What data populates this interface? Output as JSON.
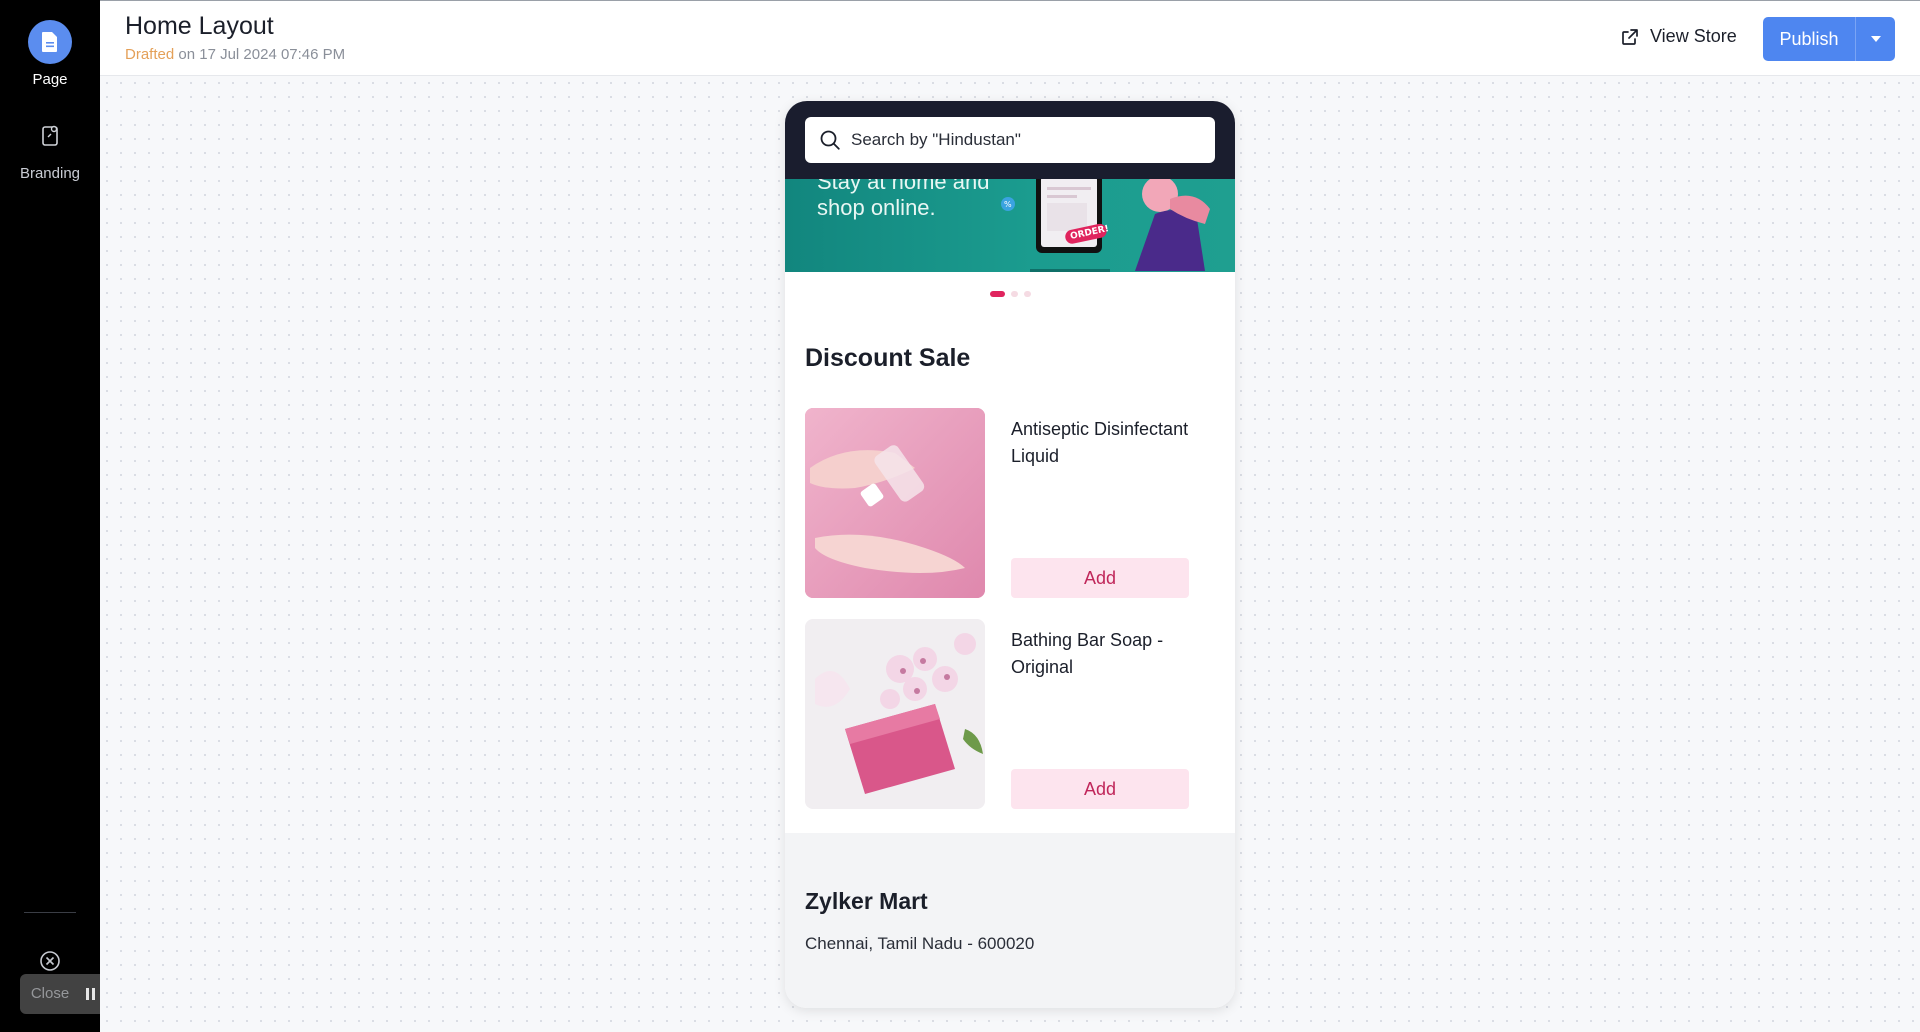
{
  "sidebar": {
    "items": [
      {
        "label": "Page",
        "icon": "page-icon",
        "active": true
      },
      {
        "label": "Branding",
        "icon": "branding-icon",
        "active": false
      }
    ],
    "close_label": "Close"
  },
  "header": {
    "title": "Home Layout",
    "subtitle_status": "Drafted",
    "subtitle_rest": " on 17 Jul 2024 07:46 PM",
    "view_store_label": "View Store",
    "publish_label": "Publish"
  },
  "preview": {
    "search_placeholder": "Search by \"Hindustan\"",
    "banner": {
      "line1": "Stay at home and",
      "line2": "shop online.",
      "badge": "ORDER!"
    },
    "carousel": {
      "count": 3,
      "active": 0
    },
    "section_title": "Discount Sale",
    "products": [
      {
        "name": "Antiseptic Disinfectant Liquid",
        "add_label": "Add"
      },
      {
        "name": "Bathing Bar Soap - Original",
        "add_label": "Add"
      }
    ],
    "footer": {
      "store_name": "Zylker Mart",
      "address": "Chennai, Tamil Nadu - 600020"
    }
  },
  "colors": {
    "accent": "#4e86f0",
    "pink": "#e0245e",
    "add_bg": "#fde4ee",
    "phone_top": "#1a1d2e",
    "banner": "#1b9c8f"
  }
}
